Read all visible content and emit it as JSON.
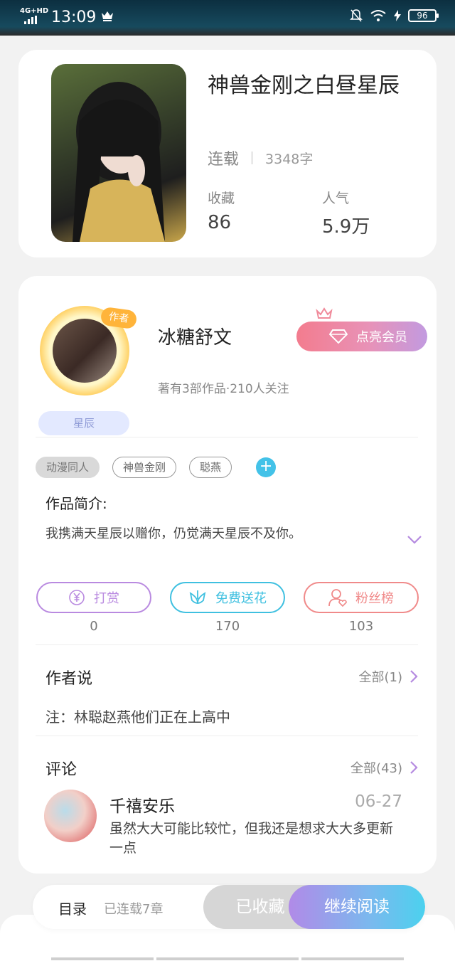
{
  "status_bar": {
    "network": "4G+HD",
    "time": "13:09",
    "battery": "96"
  },
  "book": {
    "title": "神兽金刚之白昼星辰",
    "status": "连载",
    "word_count": "3348字",
    "collect_label": "收藏",
    "collect_value": "86",
    "popularity_label": "人气",
    "popularity_value": "5.9万"
  },
  "author": {
    "tag": "作者",
    "badge": "星辰",
    "name": "冰糖舒文",
    "meta": "著有3部作品·210人关注",
    "vip_button": "点亮会员"
  },
  "tags": [
    "动漫同人",
    "神兽金刚",
    "聪燕"
  ],
  "intro": {
    "title": "作品简介:",
    "text": "我携满天星辰以赠你，仍觉满天星辰不及你。"
  },
  "actions": {
    "reward": {
      "label": "打赏",
      "count": "0",
      "color": "#b98ae0"
    },
    "flower": {
      "label": "免费送花",
      "count": "170",
      "color": "#3fc0e0"
    },
    "fans": {
      "label": "粉丝榜",
      "count": "103",
      "color": "#f08a8a"
    }
  },
  "author_says": {
    "title": "作者说",
    "more": "全部(1)",
    "note": "注：林聪赵燕他们正在上高中"
  },
  "comments": {
    "title": "评论",
    "more": "全部(43)",
    "items": [
      {
        "user": "千禧安乐",
        "date": "06-27",
        "text": "虽然大大可能比较忙，但我还是想求大大多更新一点"
      }
    ]
  },
  "bottom_bar": {
    "menu": "目录",
    "chapters": "已连载7章",
    "collected": "已收藏",
    "continue": "继续阅读"
  }
}
